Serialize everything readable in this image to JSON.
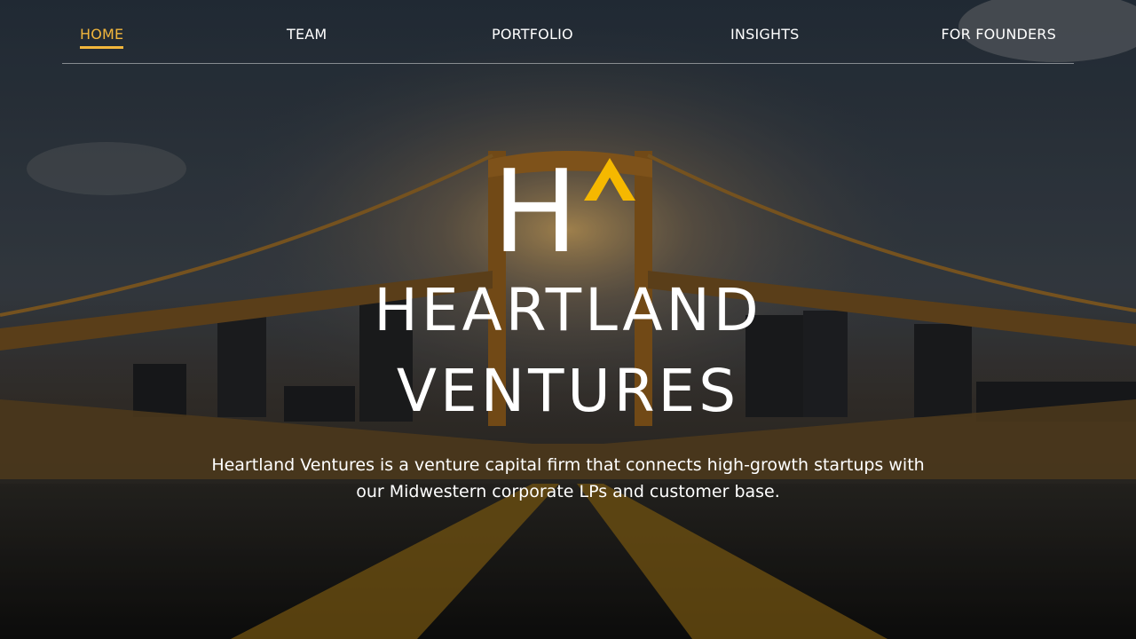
{
  "nav": {
    "items": [
      {
        "label": "HOME",
        "active": true
      },
      {
        "label": "TEAM",
        "active": false
      },
      {
        "label": "PORTFOLIO",
        "active": false
      },
      {
        "label": "INSIGHTS",
        "active": false
      },
      {
        "label": "FOR FOUNDERS",
        "active": false
      }
    ]
  },
  "brand": {
    "logo_letter": "H",
    "name_line1": "HEARTLAND",
    "name_line2": "VENTURES"
  },
  "hero": {
    "tagline": "Heartland Ventures is a venture capital firm that connects high-growth startups with our Midwestern corporate LPs and customer base.",
    "background": "bridge-road-sunset-photo"
  },
  "colors": {
    "accent": "#f2b63c",
    "logo_caret": "#f5b800",
    "text": "#ffffff"
  }
}
